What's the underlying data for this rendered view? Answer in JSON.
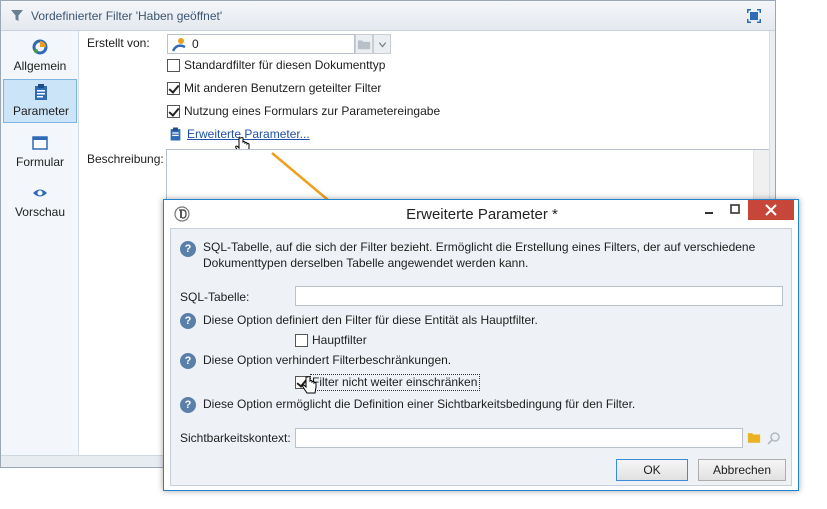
{
  "back_window": {
    "title": "Vordefinierter Filter 'Haben geöffnet'",
    "nav": [
      {
        "label": "Allgemein",
        "icon": "general-icon"
      },
      {
        "label": "Parameter",
        "icon": "clipboard-icon",
        "active": true
      },
      {
        "label": "Formular",
        "icon": "form-icon"
      },
      {
        "label": "Vorschau",
        "icon": "eye-icon"
      }
    ],
    "created_by_label": "Erstellt von:",
    "created_by_value": "0",
    "checkboxes": [
      {
        "label": "Standardfilter für diesen Dokumenttyp",
        "checked": false
      },
      {
        "label": "Mit anderen Benutzern geteilter Filter",
        "checked": true
      },
      {
        "label": "Nutzung eines Formulars zur Parametereingabe",
        "checked": true
      }
    ],
    "advanced_link": "Erweiterte Parameter...",
    "description_label": "Beschreibung:"
  },
  "dialog": {
    "title": "Erweiterte Parameter *",
    "intro_help": "SQL-Tabelle, auf die sich der Filter bezieht. Ermöglicht die Erstellung eines Filters, der auf verschiedene",
    "intro_help_2": "Dokumenttypen derselben Tabelle angewendet werden kann.",
    "sql_table_label": "SQL-Tabelle:",
    "sql_table_value": "",
    "main_filter_help": "Diese Option definiert den Filter für diese Entität als Hauptfilter.",
    "main_filter_label": "Hauptfilter",
    "main_filter_checked": false,
    "no_restrict_help": "Diese Option verhindert Filterbeschränkungen.",
    "no_restrict_label": "Filter nicht weiter einschränken",
    "no_restrict_checked": true,
    "visibility_help": "Diese Option ermöglicht die Definition einer Sichtbarkeitsbedingung für den Filter.",
    "visibility_label": "Sichtbarkeitskontext:",
    "visibility_value": "",
    "ok_label": "OK",
    "cancel_label": "Abbrechen"
  },
  "colors": {
    "accent": "#1e84d0",
    "link": "#1f4fa8",
    "arrow": "#f0a020",
    "close": "#c7463a"
  }
}
